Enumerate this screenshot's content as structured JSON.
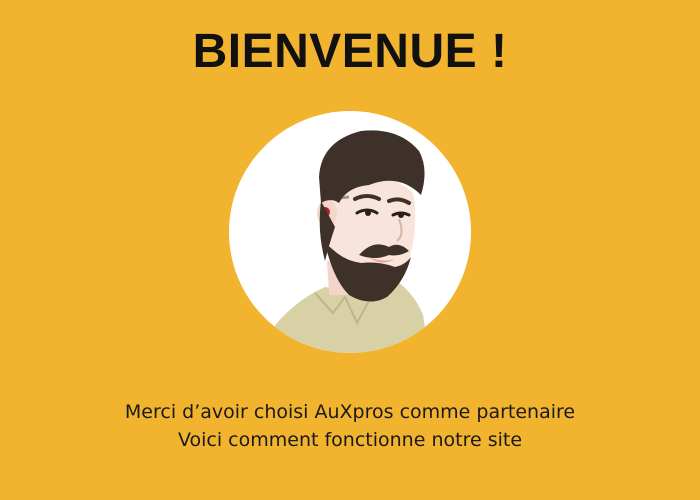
{
  "welcome": {
    "title": "BIENVENUE !",
    "lines": [
      "Merci d’avoir choisi AuXpros comme partenaire",
      "Voici comment fonctionne notre site"
    ]
  },
  "colors": {
    "background": "#F2B32F",
    "title": "#111111",
    "text": "#1A1A1A",
    "avatar_circle": "#FFFFFF",
    "hair": "#3E3129",
    "skin": "#F8E4DA",
    "shirt": "#D8D1A5"
  },
  "icons": {
    "avatar": "bearded-man-avatar"
  }
}
